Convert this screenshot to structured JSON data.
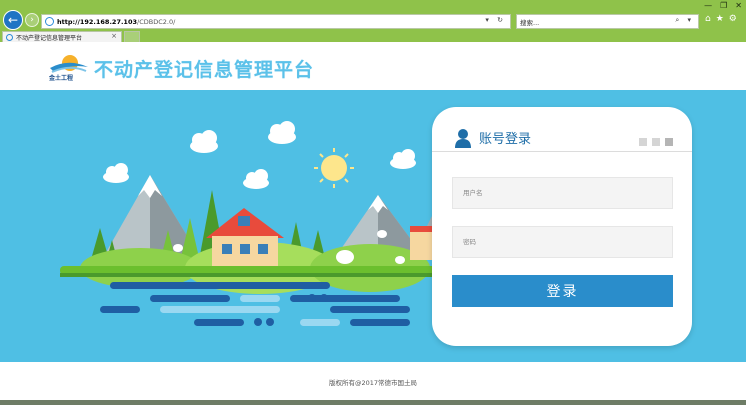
{
  "browser": {
    "address_host": "http://192.168.27.103",
    "address_path": "/CDBDC2.0/",
    "address_controls": "▾ ↻",
    "search_placeholder": "搜索...",
    "search_controls": "⌕ ▾",
    "tab_title": "不动产登记信息管理平台",
    "tab_close": "×",
    "window_controls": [
      "—",
      "❐",
      "✕"
    ],
    "toolbar_icons": [
      "⌂",
      "★",
      "⚙"
    ],
    "back_glyph": "←",
    "forward_glyph": "›"
  },
  "header": {
    "logo_text": "金土工程",
    "site_title": "不动产登记信息管理平台"
  },
  "login": {
    "title": "账号登录",
    "username_placeholder": "用户名",
    "password_placeholder": "密码",
    "submit_label": "登录"
  },
  "footer": {
    "copyright": "版权所有@2017常德市国土局"
  },
  "colors": {
    "chrome": "#8fc24a",
    "banner": "#4fbfe4",
    "accent": "#2a8dcb",
    "title": "#5bc1e9"
  },
  "icons": [
    "back-arrow-icon",
    "forward-arrow-icon",
    "ie-icon",
    "home-icon",
    "star-icon",
    "gear-icon",
    "user-icon",
    "sun-icon",
    "cloud-icon"
  ]
}
